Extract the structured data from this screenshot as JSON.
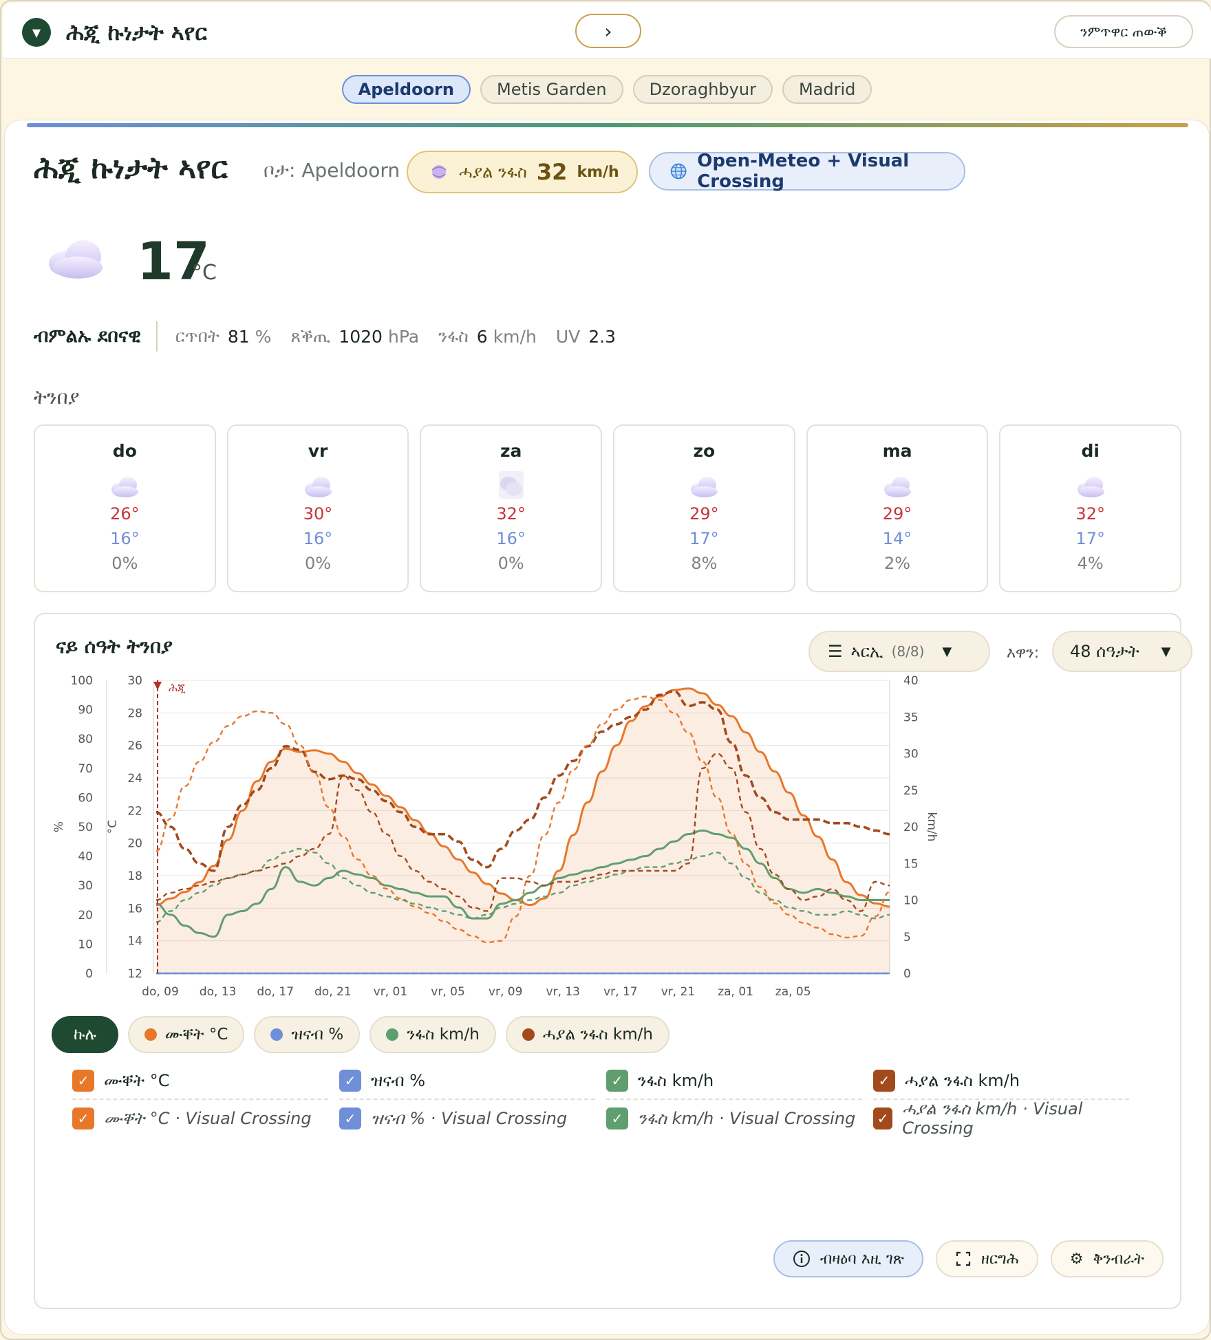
{
  "app": {
    "title": "ሕጂ ኩነታት ኣየር",
    "toggle_icon": "▼",
    "next_icon": "›",
    "compare_label": "ንምጥዋር ጠውቕ"
  },
  "cities": [
    "Apeldoorn",
    "Metis Garden",
    "Dzoraghbyur",
    "Madrid"
  ],
  "active_city": "Apeldoorn",
  "header": {
    "title": "ሕጂ ኩነታት ኣየር",
    "location": "ቦታ: Apeldoorn",
    "gust_label": "ሓያል ንፋስ",
    "gust_value": "32",
    "gust_unit": "km/h",
    "source": "Open-Meteo + Visual Crossing"
  },
  "current": {
    "temp": "17",
    "unit": "°C",
    "condition": "ብምልኡ ደበናዊ",
    "humidity_label": "ርጥበት",
    "humidity_value": "81",
    "humidity_unit": "%",
    "pressure_label": "ጸቕጢ",
    "pressure_value": "1020",
    "pressure_unit": "hPa",
    "wind_label": "ንፋስ",
    "wind_value": "6",
    "wind_unit": "km/h",
    "uv_label": "UV",
    "uv_value": "2.3"
  },
  "forecast": {
    "title": "ትንበያ",
    "days": [
      {
        "day": "do",
        "icon": "cloud-icon",
        "hi": "26°",
        "lo": "16°",
        "precip": "0%"
      },
      {
        "day": "vr",
        "icon": "cloud-icon",
        "hi": "30°",
        "lo": "16°",
        "precip": "0%"
      },
      {
        "day": "za",
        "icon": "cloud-icon",
        "hi": "32°",
        "lo": "16°",
        "precip": "0%"
      },
      {
        "day": "zo",
        "icon": "cloud-icon",
        "hi": "29°",
        "lo": "17°",
        "precip": "8%"
      },
      {
        "day": "ma",
        "icon": "cloud-icon",
        "hi": "29°",
        "lo": "14°",
        "precip": "2%"
      },
      {
        "day": "di",
        "icon": "cloud-icon",
        "hi": "32°",
        "lo": "17°",
        "precip": "4%"
      }
    ]
  },
  "hourly": {
    "title": "ናይ ሰዓት ትንበያ",
    "series_label": "ኣርኢ",
    "series_count": "(8/8)",
    "range_label": "እዋን:",
    "range_value": "48 ሰዓታት",
    "now_label": "ሕጂ",
    "legend": {
      "all": "ኩሉ",
      "temp": "ሙቐት °C",
      "humidity": "ዝናብ %",
      "wind": "ንፋስ km/h",
      "gust": "ሓያል ንፋስ km/h"
    },
    "checks": {
      "temp": "ሙቐት °C",
      "humidity": "ዝናብ %",
      "wind": "ንፋስ km/h",
      "gust": "ሓያል ንፋስ km/h",
      "temp_vc": "ሙቐት °C · Visual Crossing",
      "humidity_vc": "ዝናብ % · Visual Crossing",
      "wind_vc": "ንፋስ km/h · Visual Crossing",
      "gust_vc": "ሓያል ንፋስ km/h · Visual Crossing"
    },
    "actions": {
      "info": "ብዛዕባ እዚ ገጽ",
      "fullscreen": "ዘርግሕ",
      "settings": "ቅንብራት"
    }
  },
  "colors": {
    "temp": "#e8772a",
    "humidity": "#6f8fd8",
    "wind": "#5f9e6e",
    "gust": "#a34a1c",
    "now_marker": "#b0302c"
  },
  "chart_data": {
    "type": "line",
    "x_ticks": [
      "do, 09",
      "do, 13",
      "do, 17",
      "do, 21",
      "vr, 01",
      "vr, 05",
      "vr, 09",
      "vr, 13",
      "vr, 17",
      "vr, 21",
      "za, 01",
      "za, 05"
    ],
    "axes": {
      "left_pct": {
        "label": "%",
        "range": [
          0,
          100
        ],
        "ticks": [
          0,
          10,
          20,
          30,
          40,
          50,
          60,
          70,
          80,
          90,
          100
        ]
      },
      "left_temp": {
        "label": "°C",
        "range": [
          12,
          30
        ],
        "ticks": [
          12,
          14,
          16,
          18,
          20,
          22,
          24,
          26,
          28,
          30
        ]
      },
      "right_kmh": {
        "label": "km/h",
        "range": [
          0,
          40
        ],
        "ticks": [
          0,
          5,
          10,
          15,
          20,
          25,
          30,
          35,
          40
        ]
      }
    },
    "grid": true,
    "series": [
      {
        "name": "ሙቐት °C",
        "axis": "left_temp",
        "color": "#e8772a",
        "style": "solid",
        "fill": true,
        "values": [
          16.2,
          16.6,
          17.0,
          17.6,
          18.6,
          20.2,
          22.0,
          23.8,
          25.0,
          25.8,
          25.6,
          25.7,
          25.5,
          25.0,
          24.3,
          23.6,
          22.9,
          22.2,
          21.4,
          20.6,
          19.8,
          19.0,
          18.2,
          17.5,
          16.9,
          16.5,
          16.2,
          16.6,
          18.3,
          20.5,
          22.5,
          24.4,
          26.0,
          27.5,
          28.4,
          29.0,
          29.4,
          29.5,
          29.2,
          28.5,
          27.8,
          26.8,
          25.6,
          24.4,
          23.1,
          21.7,
          20.4,
          19.0,
          17.6,
          16.8,
          16.3,
          16.1
        ]
      },
      {
        "name": "ዝናብ %",
        "axis": "left_pct",
        "color": "#6f8fd8",
        "style": "solid",
        "values": [
          0,
          0,
          0,
          0,
          0,
          0,
          0,
          0,
          0,
          0,
          0,
          0,
          0,
          0,
          0,
          0,
          0,
          0,
          0,
          0,
          0,
          0,
          0,
          0,
          0,
          0,
          0,
          0,
          0,
          0,
          0,
          0,
          0,
          0,
          0,
          0,
          0,
          0,
          0,
          0,
          0,
          0,
          0,
          0,
          0,
          0,
          0,
          0,
          0,
          0,
          0,
          0
        ]
      },
      {
        "name": "ንፋስ km/h",
        "axis": "right_kmh",
        "color": "#5f9e6e",
        "style": "solid",
        "values": [
          9.5,
          8.0,
          6.5,
          5.5,
          5.0,
          8.0,
          8.5,
          9.5,
          11.5,
          14.5,
          12.5,
          12.0,
          13.0,
          14.0,
          13.5,
          13.0,
          12.0,
          11.5,
          11.0,
          10.5,
          10.5,
          9.0,
          7.5,
          7.5,
          9.5,
          10.0,
          11.0,
          12.0,
          13.0,
          13.5,
          14.0,
          14.5,
          15.0,
          15.5,
          16.0,
          17.0,
          18.0,
          19.0,
          19.5,
          19.0,
          18.5,
          17.0,
          15.0,
          13.0,
          11.5,
          11.0,
          11.5,
          11.0,
          10.5,
          10.0,
          10.0,
          10.0
        ]
      },
      {
        "name": "ሓያል ንፋስ km/h",
        "axis": "right_kmh",
        "color": "#a34a1c",
        "style": "solid-dashed",
        "values": [
          22.0,
          20.0,
          17.0,
          15.0,
          14.0,
          20.0,
          23.0,
          25.0,
          28.0,
          31.0,
          30.5,
          27.5,
          26.5,
          27.0,
          26.5,
          25.0,
          23.5,
          22.0,
          20.0,
          19.0,
          19.0,
          18.0,
          15.5,
          14.5,
          17.0,
          19.5,
          21.0,
          24.0,
          27.0,
          29.0,
          31.0,
          33.0,
          34.0,
          35.0,
          36.0,
          38.0,
          38.5,
          36.5,
          37.0,
          36.0,
          31.5,
          27.0,
          24.0,
          22.0,
          21.0,
          21.0,
          21.0,
          20.5,
          20.5,
          20.0,
          19.5,
          19.0
        ]
      },
      {
        "name": "ሙቐት °C · Visual Crossing",
        "axis": "left_temp",
        "color": "#e8772a",
        "style": "dashed",
        "values": [
          19.5,
          21.5,
          23.5,
          25.0,
          26.2,
          27.2,
          27.8,
          28.1,
          28.0,
          27.3,
          26.0,
          24.3,
          22.2,
          20.4,
          19.0,
          18.0,
          17.2,
          16.6,
          16.1,
          15.7,
          15.2,
          14.7,
          14.3,
          13.9,
          14.0,
          15.5,
          18.0,
          20.5,
          22.5,
          24.5,
          26.0,
          27.3,
          28.2,
          28.8,
          29.0,
          28.8,
          28.0,
          26.8,
          25.0,
          22.8,
          20.6,
          18.7,
          17.3,
          16.3,
          15.6,
          15.1,
          14.8,
          14.4,
          14.2,
          14.3,
          15.5,
          17.0
        ]
      },
      {
        "name": "ዝናብ % · Visual Crossing",
        "axis": "left_pct",
        "color": "#6f8fd8",
        "style": "dashed",
        "values": [
          0,
          0,
          0,
          0,
          0,
          0,
          0,
          0,
          0,
          0,
          0,
          0,
          0,
          0,
          0,
          0,
          0,
          0,
          0,
          0,
          0,
          0,
          0,
          0,
          0,
          0,
          0,
          0,
          0,
          0,
          0,
          0,
          0,
          0,
          0,
          0,
          0,
          0,
          0,
          0,
          0,
          0,
          0,
          0,
          0,
          0,
          0,
          0,
          0,
          0,
          0,
          0
        ]
      },
      {
        "name": "ንፋስ km/h · Visual Crossing",
        "axis": "right_kmh",
        "color": "#5f9e6e",
        "style": "dashed",
        "values": [
          7.0,
          8.5,
          10.0,
          11.0,
          12.0,
          13.0,
          13.5,
          14.0,
          15.5,
          16.5,
          17.0,
          16.5,
          15.0,
          13.0,
          12.0,
          11.0,
          10.5,
          10.0,
          9.5,
          9.0,
          8.5,
          8.0,
          7.5,
          8.0,
          9.0,
          9.5,
          10.0,
          10.5,
          11.0,
          12.0,
          12.5,
          13.0,
          13.5,
          14.0,
          14.5,
          14.5,
          15.0,
          15.5,
          16.0,
          16.5,
          15.0,
          13.0,
          11.0,
          10.0,
          9.0,
          8.5,
          8.0,
          8.0,
          8.5,
          8.0,
          7.5,
          8.0
        ]
      },
      {
        "name": "ሓያል ንፋስ km/h · Visual Crossing",
        "axis": "right_kmh",
        "color": "#a34a1c",
        "style": "dashed",
        "values": [
          10.0,
          11.0,
          11.5,
          12.0,
          12.5,
          13.0,
          13.5,
          14.0,
          14.5,
          15.0,
          16.0,
          17.0,
          19.0,
          27.0,
          25.0,
          22.0,
          19.0,
          16.0,
          14.0,
          12.5,
          11.5,
          10.5,
          9.0,
          8.5,
          13.0,
          13.0,
          12.5,
          12.0,
          12.5,
          12.5,
          13.0,
          13.5,
          14.0,
          14.0,
          14.0,
          14.0,
          14.0,
          15.0,
          28.0,
          30.0,
          28.0,
          22.0,
          17.0,
          13.5,
          11.5,
          10.0,
          10.5,
          11.5,
          10.0,
          8.5,
          12.5,
          12.0
        ]
      }
    ]
  }
}
